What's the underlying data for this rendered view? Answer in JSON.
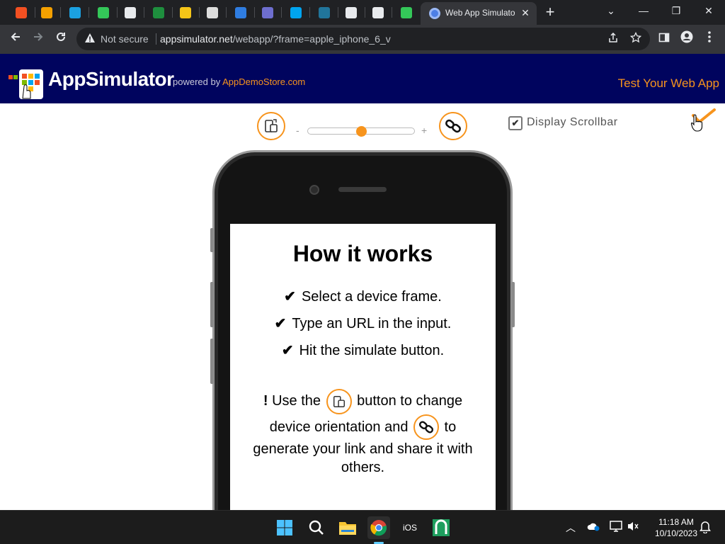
{
  "browser": {
    "active_tab": {
      "title": "Web App Simulator",
      "close": "✕"
    },
    "new_tab": "+",
    "window_controls": {
      "minimize": "—",
      "maximize": "❐",
      "close": "✕",
      "tab_search": "⌄"
    },
    "security_label": "Not secure",
    "url_host": "appsimulator.net",
    "url_path": "/webapp/?frame=apple_iphone_6_v",
    "pinned_tabs": [
      {
        "icon": "windows-icon",
        "color": "#f25022"
      },
      {
        "icon": "windows-old-icon",
        "color": "#f4a000"
      },
      {
        "icon": "target-icon",
        "color": "#1ba1e2"
      },
      {
        "icon": "arrow-icon",
        "color": "#34c759"
      },
      {
        "icon": "globe-icon",
        "color": "#e8eaed"
      },
      {
        "icon": "sheet-icon",
        "color": "#1e8e3e"
      },
      {
        "icon": "bug-icon",
        "color": "#f5c518"
      },
      {
        "icon": "troll-icon",
        "color": "#dddddd"
      },
      {
        "icon": "finder-icon",
        "color": "#2f7de1"
      },
      {
        "icon": "cat-icon",
        "color": "#6e6ecf"
      },
      {
        "icon": "windows-tiles-icon",
        "color": "#00a4ef"
      },
      {
        "icon": "wordpress-icon",
        "color": "#21759b"
      },
      {
        "icon": "feather-icon",
        "color": "#e8eaed"
      },
      {
        "icon": "globe-icon",
        "color": "#e8eaed"
      },
      {
        "icon": "apple-icon",
        "color": "#34c759"
      }
    ]
  },
  "header": {
    "brand": "AppSimulator",
    "powered_by": "powered by ",
    "store_link": "AppDemoStore.com",
    "test_link": "Test Your Web App",
    "colors": {
      "background": "#00045e",
      "accent": "#f7941d"
    }
  },
  "controls": {
    "zoom_minus": "-",
    "zoom_plus": "+",
    "zoom_level": 0.5,
    "scrollbar_label": "Display Scrollbar",
    "scrollbar_checked": true,
    "checkmark": "✔"
  },
  "screen": {
    "title": "How it works",
    "tick": "✔",
    "steps": [
      "Select a device frame.",
      "Type an URL in the input.",
      "Hit the simulate button."
    ],
    "note_bang": "!",
    "note_part1": " Use the ",
    "note_part2": " button to change",
    "note_part3": "device orientation and ",
    "note_part4": " to",
    "note_part5": "generate your link and share it with others."
  },
  "taskbar": {
    "ios_label": "iOS",
    "time": "11:18 AM",
    "date": "10/10/2023",
    "tray": {
      "chevron": "︿"
    }
  }
}
